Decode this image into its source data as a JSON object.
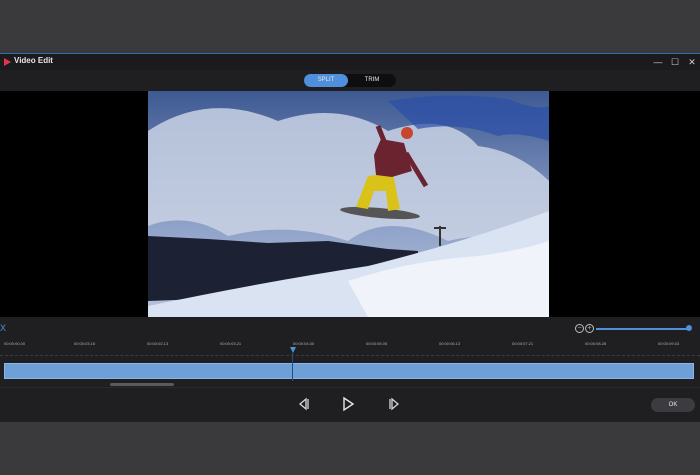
{
  "window": {
    "title": "Video Edit",
    "icon": "video-edit-icon"
  },
  "titlebar_buttons": {
    "minimize": "—",
    "maximize": "☐",
    "close": "✕"
  },
  "tabs": [
    {
      "label": "SPLIT",
      "active": true
    },
    {
      "label": "TRIM",
      "active": false
    }
  ],
  "video": {
    "content": "snowboarder-jump-frame"
  },
  "timeline": {
    "close_label": "X",
    "zoom_out": "−",
    "zoom_in": "+",
    "zoom_level_fraction": 1.0,
    "ticks": [
      "00:00:00.00",
      "00:00:03.16",
      "00:00:02.13",
      "00:00:03.21",
      "00:00:04.00",
      "00:00:05.05",
      "00:00:06.13",
      "00:00:07.21",
      "00:00:08.28",
      "00:00:09.03"
    ],
    "playhead_time": "00:00:04.00"
  },
  "controls": {
    "ok_label": "OK"
  },
  "colors": {
    "accent": "#4f8fdc",
    "clip": "#6e9fd6",
    "background": "#1f1f22"
  }
}
